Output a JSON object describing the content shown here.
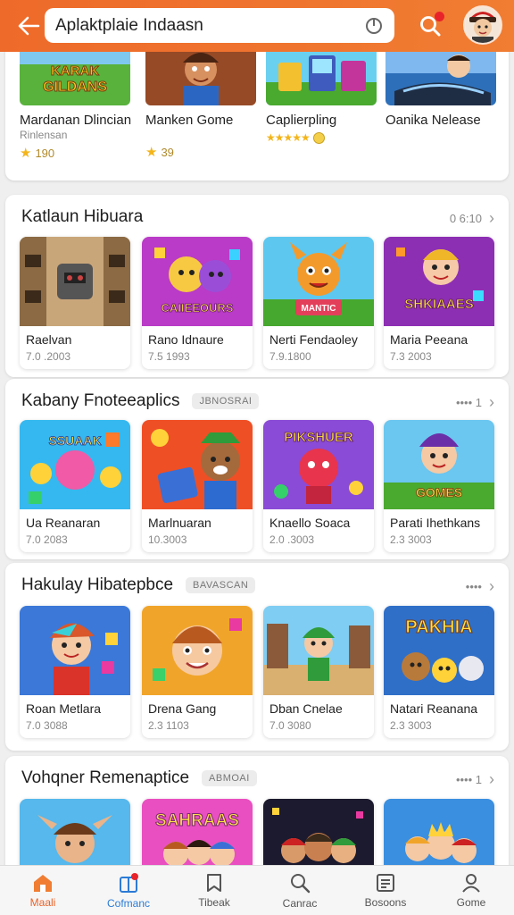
{
  "header": {
    "search_value": "Aplaktplaie Indaasn",
    "accent": "#ee6a2a"
  },
  "featured": {
    "items": [
      {
        "title": "Mardanan Dlincian",
        "sub": "Rinlensan",
        "rating": "190",
        "art": "KARAK GILDANS"
      },
      {
        "title": "Manken Gome",
        "sub": "",
        "rating": "39",
        "art": ""
      },
      {
        "title": "Caplierpling",
        "sub": "",
        "rating": "★★★★★",
        "art": ""
      },
      {
        "title": "Oanika Nelease",
        "sub": "",
        "rating": "",
        "art": ""
      }
    ]
  },
  "sections": [
    {
      "title": "Katlaun Hibuara",
      "badge": "",
      "more": "0 6:10",
      "items": [
        {
          "title": "Raelvan",
          "sub": "7.0 .2003",
          "art": ""
        },
        {
          "title": "Rano Idnaure",
          "sub": "7.5 1993",
          "art": "CAIIEEOURS"
        },
        {
          "title": "Nerti Fendaoley",
          "sub": "7.9.1800",
          "art": "MANTIC"
        },
        {
          "title": "Maria Peeana",
          "sub": "7.3 2003",
          "art": "SHKIAAES"
        }
      ]
    },
    {
      "title": "Kabany Fnoteeaplics",
      "badge": "JBNOSRAI",
      "more": "•••• 1",
      "items": [
        {
          "title": "Ua Reanaran",
          "sub": "7.0 2083",
          "art": "SSUAAK"
        },
        {
          "title": "Marlnuaran",
          "sub": "10.3003",
          "art": ""
        },
        {
          "title": "Knaello Soaca",
          "sub": "2.0 .3003",
          "art": "PIKSHUER"
        },
        {
          "title": "Parati Ihethkans",
          "sub": "2.3 3003",
          "art": "GOMES"
        }
      ]
    },
    {
      "title": "Hakulay Hibatepbce",
      "badge": "BAVASCAN",
      "more": "••••",
      "items": [
        {
          "title": "Roan Metlara",
          "sub": "7.0 3088",
          "art": ""
        },
        {
          "title": "Drena Gang",
          "sub": "2.3 1103",
          "art": ""
        },
        {
          "title": "Dban Cnelae",
          "sub": "7.0 3080",
          "art": ""
        },
        {
          "title": "Natari Reanana",
          "sub": "2.3 3003",
          "art": "PAKHIA"
        }
      ]
    },
    {
      "title": "Vohqner Remenaptice",
      "badge": "ABMOAI",
      "more": "•••• 1",
      "items": [
        {
          "title": "",
          "sub": "",
          "art": ""
        },
        {
          "title": "",
          "sub": "",
          "art": "SAHRAAS"
        },
        {
          "title": "",
          "sub": "",
          "art": ""
        },
        {
          "title": "",
          "sub": "",
          "art": ""
        }
      ]
    }
  ],
  "nav": [
    {
      "label": "Maali",
      "icon": "home-icon"
    },
    {
      "label": "Cofmanc",
      "icon": "gift-icon"
    },
    {
      "label": "Tibeak",
      "icon": "book-icon"
    },
    {
      "label": "Canrac",
      "icon": "search-icon"
    },
    {
      "label": "Bosoons",
      "icon": "list-icon"
    },
    {
      "label": "Gome",
      "icon": "user-icon"
    }
  ]
}
